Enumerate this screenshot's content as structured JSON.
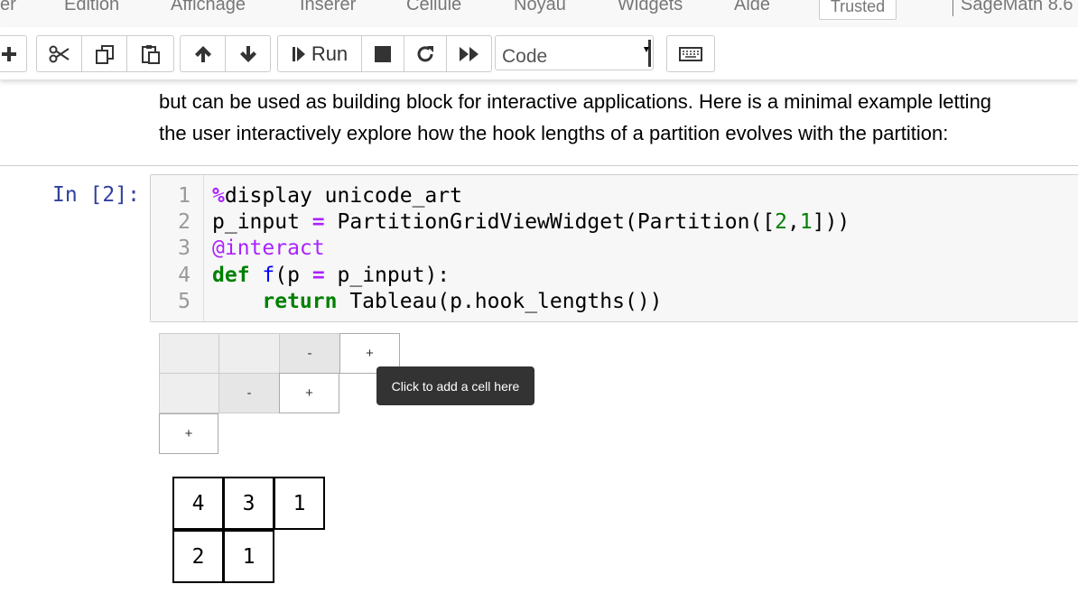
{
  "menubar": {
    "items": [
      {
        "label": "er"
      },
      {
        "label": "Edition"
      },
      {
        "label": "Affichage"
      },
      {
        "label": "Insérer"
      },
      {
        "label": "Cellule"
      },
      {
        "label": "Noyau"
      },
      {
        "label": "Widgets"
      },
      {
        "label": "Aide"
      }
    ],
    "trusted_label": "Trusted",
    "kernel_label": "SageMath 8.6"
  },
  "toolbar": {
    "run_label": "Run",
    "cell_type": "Code"
  },
  "markdown": {
    "lines": [
      "but can be used as building block for interactive applications. Here is a minimal example letting",
      "the user interactively explore how the hook lengths of a partition evolves with the partition:"
    ]
  },
  "code_cell": {
    "prompt": "In [2]:",
    "line_numbers": [
      "1",
      "2",
      "3",
      "4",
      "5"
    ],
    "lines": {
      "l1_op": "%",
      "l1_rest": "display unicode_art",
      "l2_a": "p_input ",
      "l2_eq": "=",
      "l2_b": " PartitionGridViewWidget(Partition([",
      "l2_n1": "2",
      "l2_comma": ",",
      "l2_n2": "1",
      "l2_c": "]))",
      "l3": "@interact",
      "l4_kw": "def",
      "l4_sp": " ",
      "l4_fn": "f",
      "l4_a": "(p ",
      "l4_eq": "=",
      "l4_b": " p_input):",
      "l5_indent": "    ",
      "l5_kw": "return",
      "l5_rest": " Tableau(p.hook_lengths())"
    }
  },
  "widget": {
    "row1": {
      "c1": "",
      "c2": "",
      "c3": "-",
      "c4": "+"
    },
    "row2": {
      "c1": "",
      "c2": "-",
      "c3": "+"
    },
    "row3": {
      "c1": "+"
    },
    "tooltip": "Click to add a cell here"
  },
  "output": {
    "tableau": [
      [
        "4",
        "3",
        "1"
      ],
      [
        "2",
        "1"
      ]
    ]
  }
}
